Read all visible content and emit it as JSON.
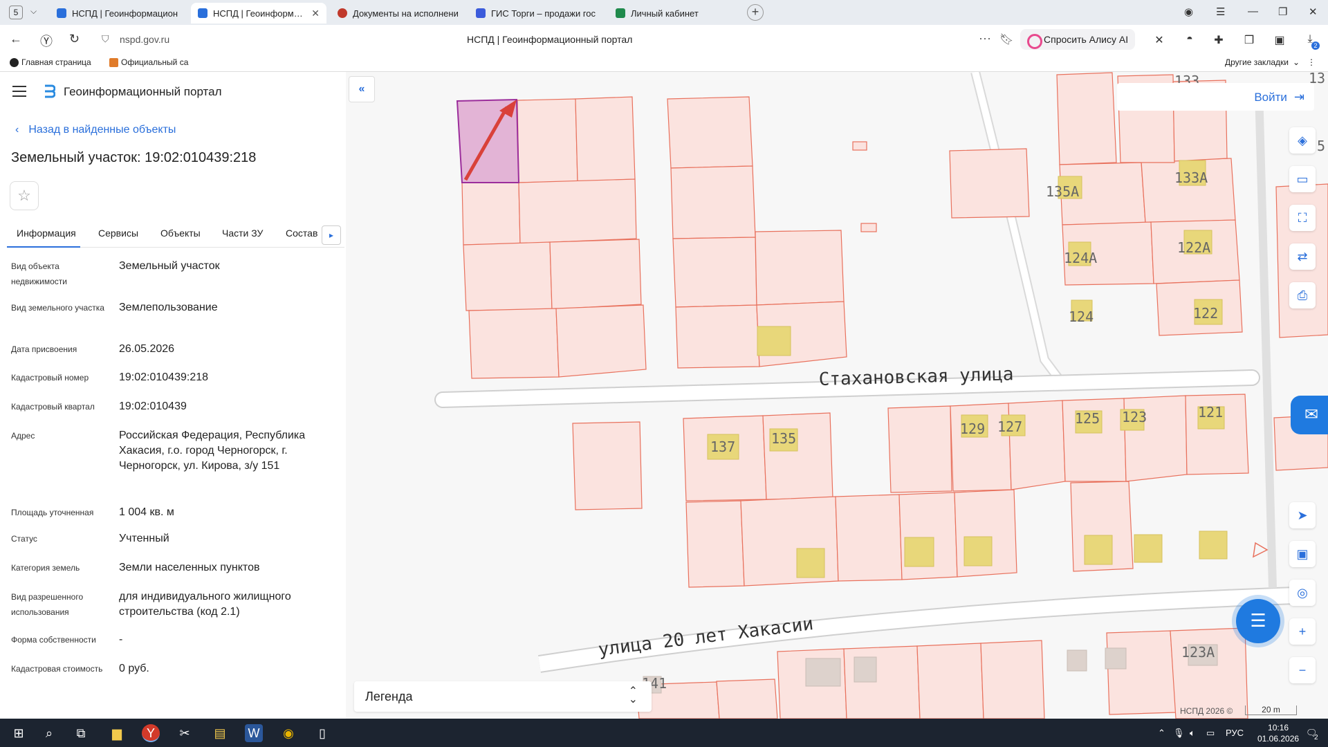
{
  "browser": {
    "tab_count": "5",
    "tabs": [
      {
        "label": "НСПД | Геоинформацион",
        "color": "#2a6fdb"
      },
      {
        "label": "НСПД | Геоинформаци",
        "color": "#2a6fdb"
      },
      {
        "label": "Документы на исполнени",
        "color": "#c0392b"
      },
      {
        "label": "ГИС Торги – продажи гос",
        "color": "#3b5bdb"
      },
      {
        "label": "Личный кабинет",
        "color": "#1f8a4c"
      }
    ],
    "url_host": "nspd.gov.ru",
    "page_title": "НСПД | Геоинформационный портал",
    "alice_label": "Спросить Алису AI",
    "bookmarks": [
      {
        "label": "Главная страница"
      },
      {
        "label": "Официальный са"
      }
    ],
    "other_bookmarks": "Другие закладки",
    "ext_badge": "2"
  },
  "portal": {
    "title": "Геоинформационный портал",
    "back_link": "Назад в найденные объекты",
    "object_title": "Земельный участок: 19:02:010439:218",
    "tabs": [
      "Информация",
      "Сервисы",
      "Объекты",
      "Части ЗУ",
      "Состав"
    ],
    "properties": [
      {
        "label": "Вид объекта недвижимости",
        "value": "Земельный участок"
      },
      {
        "label": "Вид земельного участка",
        "value": "Землепользование"
      },
      {
        "label": "Дата присвоения",
        "value": "26.05.2026"
      },
      {
        "label": "Кадастровый номер",
        "value": "19:02:010439:218"
      },
      {
        "label": "Кадастровый квартал",
        "value": "19:02:010439"
      },
      {
        "label": "Адрес",
        "value": "Российская Федерация, Республика Хакасия, г.о. город Черногорск, г. Черногорск, ул. Кирова, з/у 151"
      },
      {
        "label": "Площадь уточненная",
        "value": "1 004 кв. м"
      },
      {
        "label": "Статус",
        "value": "Учтенный"
      },
      {
        "label": "Категория земель",
        "value": "Земли населенных пунктов"
      },
      {
        "label": "Вид разрешенного использования",
        "value": "для индивидуального жилищного строительства (код 2.1)"
      },
      {
        "label": "Форма собственности",
        "value": "-"
      },
      {
        "label": "Кадастровая стоимость",
        "value": "0 руб."
      }
    ]
  },
  "map": {
    "login_label": "Войти",
    "legend_label": "Легенда",
    "copyright": "НСПД 2026 ©",
    "scale_label": "20 m",
    "streets": [
      "Стахановская улица",
      "улица 20 лет Хакасии"
    ],
    "house_numbers": [
      "135А",
      "133А",
      "124А",
      "122А",
      "124",
      "122",
      "137",
      "135",
      "129",
      "127",
      "125",
      "123",
      "121",
      "141",
      "123А",
      "13",
      "5",
      "133"
    ],
    "colors": {
      "parcel_stroke": "#e8715d",
      "parcel_fill": "#fbe3df",
      "selected_fill": "#e3b4d6",
      "selected_stroke": "#9b2d9b",
      "building": "#e8d77a",
      "arrow": "#d9413a",
      "accent": "#2a6fdb"
    }
  },
  "taskbar": {
    "lang": "РУС",
    "time": "10:16",
    "date": "01.06.2026",
    "notif_count": "2"
  }
}
